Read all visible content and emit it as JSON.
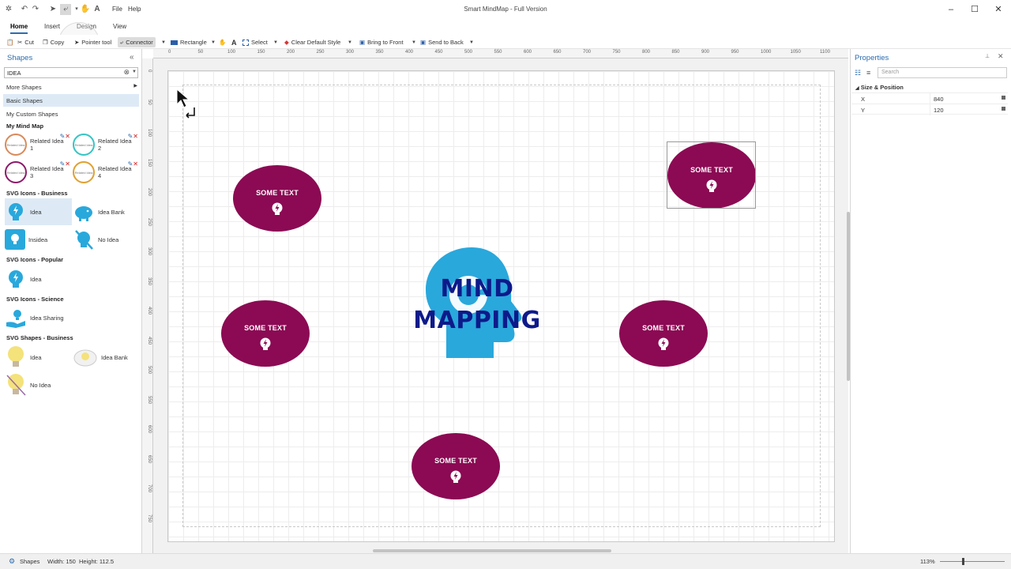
{
  "app": {
    "title": "Smart MindMap - Full Version",
    "menu": [
      "File",
      "Help"
    ]
  },
  "ribbon": {
    "tabs": [
      "Home",
      "Insert",
      "Design",
      "View"
    ],
    "active_tab": "Home"
  },
  "toolbar": {
    "cut": "Cut",
    "copy": "Copy",
    "pointer": "Pointer tool",
    "connector": "Connector",
    "rectangle": "Rectangle",
    "text_glyph": "A",
    "select": "Select",
    "clear_style": "Clear Default Style",
    "bring_front": "Bring to Front",
    "send_back": "Send to Back"
  },
  "shapes_panel": {
    "title": "Shapes",
    "collapse_glyph": "«",
    "search_value": "IDEA",
    "libraries": [
      "More Shapes",
      "Basic Shapes",
      "My Custom Shapes"
    ],
    "sections": {
      "my_mind_map": {
        "title": "My Mind Map",
        "items": [
          "Related Idea 1",
          "Related Idea 2",
          "Related Idea 3",
          "Related Idea 4"
        ],
        "ring_label": "Related Idea",
        "ring_colors": [
          "#d98a5a",
          "#35c4c4",
          "#8b1a6b",
          "#e0a030"
        ]
      },
      "svg_business": {
        "title": "SVG Icons - Business",
        "items": [
          "Idea",
          "Idea Bank",
          "Insidea",
          "No Idea"
        ]
      },
      "svg_popular": {
        "title": "SVG Icons - Popular",
        "items": [
          "Idea"
        ]
      },
      "svg_science": {
        "title": "SVG Icons - Science",
        "items": [
          "Idea Sharing"
        ]
      },
      "svg_shapes_business": {
        "title": "SVG Shapes - Business",
        "items": [
          "Idea",
          "Idea Bank",
          "No Idea"
        ]
      }
    }
  },
  "ruler": {
    "h_ticks": [
      "0",
      "50",
      "100",
      "150",
      "200",
      "250",
      "300",
      "350",
      "400",
      "450",
      "500",
      "550",
      "600",
      "650",
      "700",
      "750",
      "800",
      "850",
      "900",
      "950",
      "1000",
      "1050",
      "1100"
    ],
    "v_ticks": [
      "0",
      "50",
      "100",
      "150",
      "200",
      "250",
      "300",
      "350",
      "400",
      "450",
      "500",
      "550",
      "600",
      "650",
      "700",
      "750"
    ]
  },
  "canvas": {
    "central_topic": {
      "line1": "MIND",
      "line2": "MAPPING"
    },
    "node_color": "#8b0a53",
    "head_color": "#29a8dc",
    "nodes": [
      {
        "text": "SOME TEXT"
      },
      {
        "text": "SOME TEXT"
      },
      {
        "text": "SOME TEXT"
      },
      {
        "text": "SOME TEXT"
      },
      {
        "text": "SOME TEXT"
      }
    ]
  },
  "properties": {
    "title": "Properties",
    "search_placeholder": "Search",
    "section": "Size & Position",
    "x_label": "X",
    "x_value": "840",
    "y_label": "Y",
    "y_value": "120"
  },
  "status": {
    "shapes": "Shapes",
    "dimensions": "Width: 150  Height: 112.5",
    "zoom": "113%"
  }
}
